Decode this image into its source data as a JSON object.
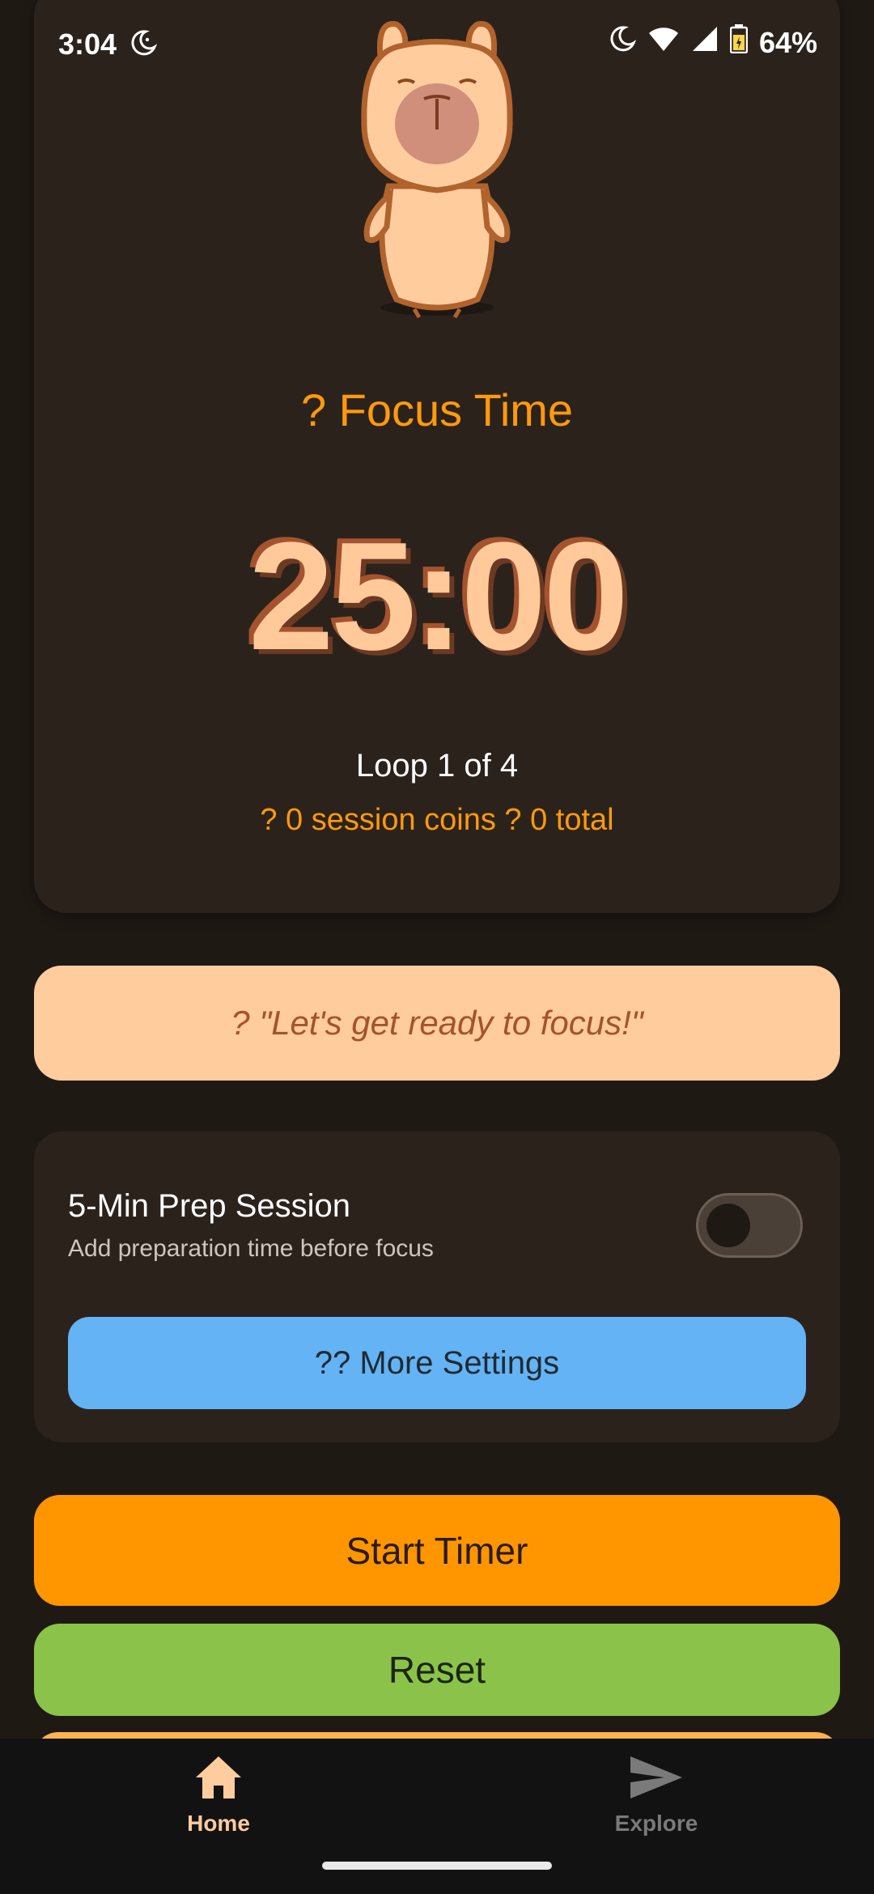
{
  "status_bar": {
    "time": "3:04",
    "battery": "64%"
  },
  "timer_card": {
    "mode_title": "? Focus Time",
    "time": "25:00",
    "loop": "Loop 1 of 4",
    "coins": "? 0 session coins ? 0 total"
  },
  "quote": "? \"Let's get ready to focus!\"",
  "settings": {
    "prep_title": "5-Min Prep Session",
    "prep_subtitle": "Add preparation time before focus",
    "prep_enabled": false,
    "more_settings_label": "?? More Settings"
  },
  "actions": {
    "start_label": "Start Timer",
    "reset_label": "Reset"
  },
  "nav": {
    "home_label": "Home",
    "explore_label": "Explore"
  },
  "colors": {
    "accent": "#ff9a0a",
    "quote_bg": "#ffcc9e",
    "settings_button": "#64b3f4",
    "start_button": "#ff9600",
    "reset_button": "#8bc34a"
  }
}
